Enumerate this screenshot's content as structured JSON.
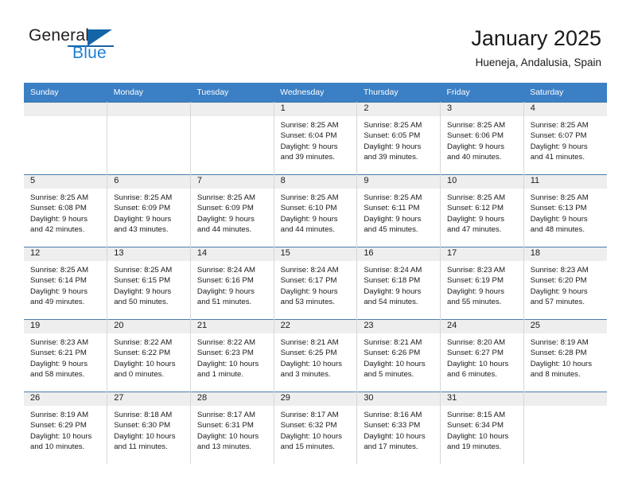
{
  "brand": {
    "name_part1": "General",
    "name_part2": "Blue",
    "accent_color": "#1464a8",
    "blue_text_color": "#1c7fd4"
  },
  "header": {
    "title": "January 2025",
    "subtitle": "Hueneja, Andalusia, Spain"
  },
  "calendar": {
    "header_bg": "#3b7fc4",
    "daynum_bg": "#eeeeee",
    "weekdays": [
      "Sunday",
      "Monday",
      "Tuesday",
      "Wednesday",
      "Thursday",
      "Friday",
      "Saturday"
    ],
    "weeks": [
      [
        {
          "day": "",
          "lines": []
        },
        {
          "day": "",
          "lines": []
        },
        {
          "day": "",
          "lines": []
        },
        {
          "day": "1",
          "lines": [
            "Sunrise: 8:25 AM",
            "Sunset: 6:04 PM",
            "Daylight: 9 hours",
            "and 39 minutes."
          ]
        },
        {
          "day": "2",
          "lines": [
            "Sunrise: 8:25 AM",
            "Sunset: 6:05 PM",
            "Daylight: 9 hours",
            "and 39 minutes."
          ]
        },
        {
          "day": "3",
          "lines": [
            "Sunrise: 8:25 AM",
            "Sunset: 6:06 PM",
            "Daylight: 9 hours",
            "and 40 minutes."
          ]
        },
        {
          "day": "4",
          "lines": [
            "Sunrise: 8:25 AM",
            "Sunset: 6:07 PM",
            "Daylight: 9 hours",
            "and 41 minutes."
          ]
        }
      ],
      [
        {
          "day": "5",
          "lines": [
            "Sunrise: 8:25 AM",
            "Sunset: 6:08 PM",
            "Daylight: 9 hours",
            "and 42 minutes."
          ]
        },
        {
          "day": "6",
          "lines": [
            "Sunrise: 8:25 AM",
            "Sunset: 6:09 PM",
            "Daylight: 9 hours",
            "and 43 minutes."
          ]
        },
        {
          "day": "7",
          "lines": [
            "Sunrise: 8:25 AM",
            "Sunset: 6:09 PM",
            "Daylight: 9 hours",
            "and 44 minutes."
          ]
        },
        {
          "day": "8",
          "lines": [
            "Sunrise: 8:25 AM",
            "Sunset: 6:10 PM",
            "Daylight: 9 hours",
            "and 44 minutes."
          ]
        },
        {
          "day": "9",
          "lines": [
            "Sunrise: 8:25 AM",
            "Sunset: 6:11 PM",
            "Daylight: 9 hours",
            "and 45 minutes."
          ]
        },
        {
          "day": "10",
          "lines": [
            "Sunrise: 8:25 AM",
            "Sunset: 6:12 PM",
            "Daylight: 9 hours",
            "and 47 minutes."
          ]
        },
        {
          "day": "11",
          "lines": [
            "Sunrise: 8:25 AM",
            "Sunset: 6:13 PM",
            "Daylight: 9 hours",
            "and 48 minutes."
          ]
        }
      ],
      [
        {
          "day": "12",
          "lines": [
            "Sunrise: 8:25 AM",
            "Sunset: 6:14 PM",
            "Daylight: 9 hours",
            "and 49 minutes."
          ]
        },
        {
          "day": "13",
          "lines": [
            "Sunrise: 8:25 AM",
            "Sunset: 6:15 PM",
            "Daylight: 9 hours",
            "and 50 minutes."
          ]
        },
        {
          "day": "14",
          "lines": [
            "Sunrise: 8:24 AM",
            "Sunset: 6:16 PM",
            "Daylight: 9 hours",
            "and 51 minutes."
          ]
        },
        {
          "day": "15",
          "lines": [
            "Sunrise: 8:24 AM",
            "Sunset: 6:17 PM",
            "Daylight: 9 hours",
            "and 53 minutes."
          ]
        },
        {
          "day": "16",
          "lines": [
            "Sunrise: 8:24 AM",
            "Sunset: 6:18 PM",
            "Daylight: 9 hours",
            "and 54 minutes."
          ]
        },
        {
          "day": "17",
          "lines": [
            "Sunrise: 8:23 AM",
            "Sunset: 6:19 PM",
            "Daylight: 9 hours",
            "and 55 minutes."
          ]
        },
        {
          "day": "18",
          "lines": [
            "Sunrise: 8:23 AM",
            "Sunset: 6:20 PM",
            "Daylight: 9 hours",
            "and 57 minutes."
          ]
        }
      ],
      [
        {
          "day": "19",
          "lines": [
            "Sunrise: 8:23 AM",
            "Sunset: 6:21 PM",
            "Daylight: 9 hours",
            "and 58 minutes."
          ]
        },
        {
          "day": "20",
          "lines": [
            "Sunrise: 8:22 AM",
            "Sunset: 6:22 PM",
            "Daylight: 10 hours",
            "and 0 minutes."
          ]
        },
        {
          "day": "21",
          "lines": [
            "Sunrise: 8:22 AM",
            "Sunset: 6:23 PM",
            "Daylight: 10 hours",
            "and 1 minute."
          ]
        },
        {
          "day": "22",
          "lines": [
            "Sunrise: 8:21 AM",
            "Sunset: 6:25 PM",
            "Daylight: 10 hours",
            "and 3 minutes."
          ]
        },
        {
          "day": "23",
          "lines": [
            "Sunrise: 8:21 AM",
            "Sunset: 6:26 PM",
            "Daylight: 10 hours",
            "and 5 minutes."
          ]
        },
        {
          "day": "24",
          "lines": [
            "Sunrise: 8:20 AM",
            "Sunset: 6:27 PM",
            "Daylight: 10 hours",
            "and 6 minutes."
          ]
        },
        {
          "day": "25",
          "lines": [
            "Sunrise: 8:19 AM",
            "Sunset: 6:28 PM",
            "Daylight: 10 hours",
            "and 8 minutes."
          ]
        }
      ],
      [
        {
          "day": "26",
          "lines": [
            "Sunrise: 8:19 AM",
            "Sunset: 6:29 PM",
            "Daylight: 10 hours",
            "and 10 minutes."
          ]
        },
        {
          "day": "27",
          "lines": [
            "Sunrise: 8:18 AM",
            "Sunset: 6:30 PM",
            "Daylight: 10 hours",
            "and 11 minutes."
          ]
        },
        {
          "day": "28",
          "lines": [
            "Sunrise: 8:17 AM",
            "Sunset: 6:31 PM",
            "Daylight: 10 hours",
            "and 13 minutes."
          ]
        },
        {
          "day": "29",
          "lines": [
            "Sunrise: 8:17 AM",
            "Sunset: 6:32 PM",
            "Daylight: 10 hours",
            "and 15 minutes."
          ]
        },
        {
          "day": "30",
          "lines": [
            "Sunrise: 8:16 AM",
            "Sunset: 6:33 PM",
            "Daylight: 10 hours",
            "and 17 minutes."
          ]
        },
        {
          "day": "31",
          "lines": [
            "Sunrise: 8:15 AM",
            "Sunset: 6:34 PM",
            "Daylight: 10 hours",
            "and 19 minutes."
          ]
        },
        {
          "day": "",
          "lines": []
        }
      ]
    ]
  }
}
